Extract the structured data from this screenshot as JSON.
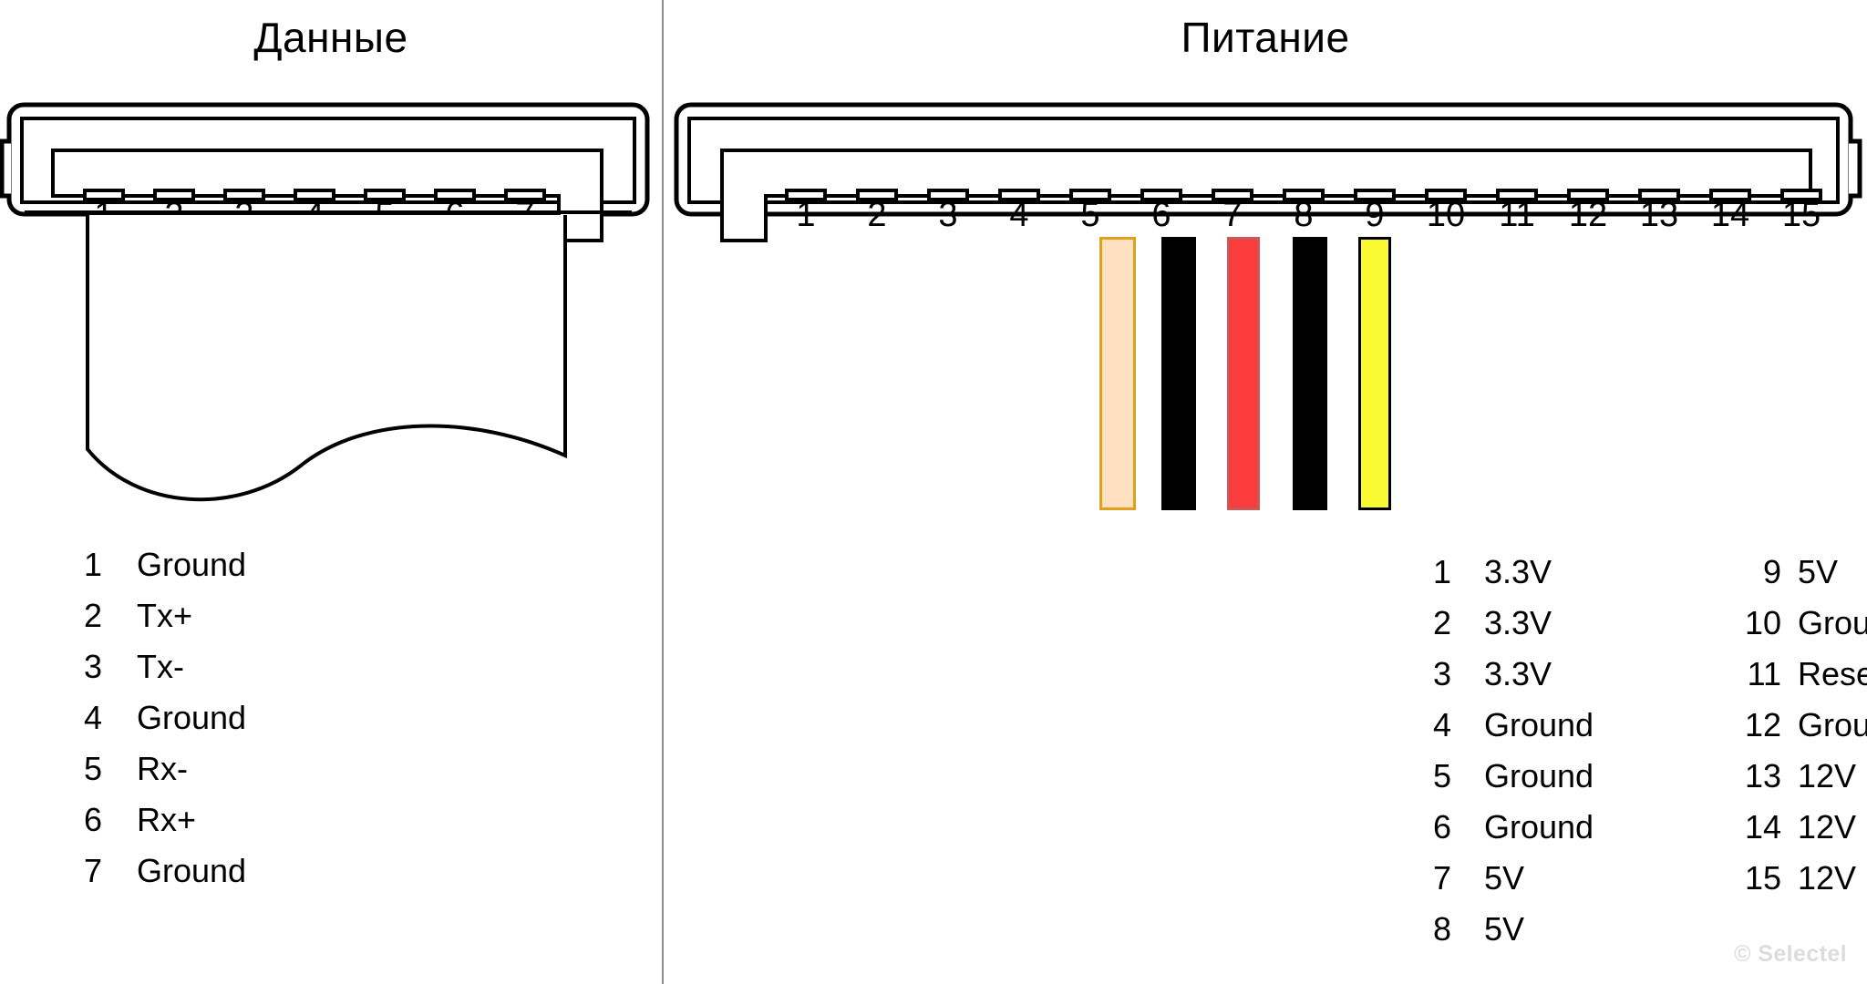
{
  "colors": {
    "outline": "#000000",
    "divider": "#8c8c8c",
    "background": "#ffffff",
    "watermark": "#dcdcdc",
    "wire_peach_fill": "#ffe0c0",
    "wire_peach_border": "#e0a01e",
    "wire_black": "#000000",
    "wire_red": "#fa3c3c",
    "wire_red_border": "#c85a5a",
    "wire_yellow": "#fafa32",
    "wire_yellow_border": "#000000"
  },
  "panels": {
    "data": {
      "title": "Данные",
      "connector": {
        "pin_count": 7,
        "pin_labels": [
          "1",
          "2",
          "3",
          "4",
          "5",
          "6",
          "7"
        ]
      },
      "pinout": [
        {
          "num": "1",
          "label": "Ground"
        },
        {
          "num": "2",
          "label": "Tx+"
        },
        {
          "num": "3",
          "label": "Tx-"
        },
        {
          "num": "4",
          "label": "Ground"
        },
        {
          "num": "5",
          "label": "Rx-"
        },
        {
          "num": "6",
          "label": "Rx+"
        },
        {
          "num": "7",
          "label": "Ground"
        }
      ]
    },
    "power": {
      "title": "Питание",
      "connector": {
        "pin_count": 15,
        "pin_labels": [
          "1",
          "2",
          "3",
          "4",
          "5",
          "6",
          "7",
          "8",
          "9",
          "10",
          "11",
          "12",
          "13",
          "14",
          "15"
        ]
      },
      "wires": [
        {
          "name": "wire-peach",
          "fill": "#ffe0c0",
          "border": "#e0a01e"
        },
        {
          "name": "wire-black-1",
          "fill": "#000000",
          "border": "#000000"
        },
        {
          "name": "wire-red",
          "fill": "#fa3c3c",
          "border": "#c85a5a"
        },
        {
          "name": "wire-black-2",
          "fill": "#000000",
          "border": "#000000"
        },
        {
          "name": "wire-yellow",
          "fill": "#fafa32",
          "border": "#000000"
        }
      ],
      "pinout_col1": [
        {
          "num": "1",
          "label": "3.3V"
        },
        {
          "num": "2",
          "label": "3.3V"
        },
        {
          "num": "3",
          "label": "3.3V"
        },
        {
          "num": "4",
          "label": "Ground"
        },
        {
          "num": "5",
          "label": "Ground"
        },
        {
          "num": "6",
          "label": "Ground"
        },
        {
          "num": "7",
          "label": "5V"
        },
        {
          "num": "8",
          "label": "5V"
        }
      ],
      "pinout_col2": [
        {
          "num": "9",
          "label": "5V"
        },
        {
          "num": "10",
          "label": "Ground"
        },
        {
          "num": "11",
          "label": "Reserved"
        },
        {
          "num": "12",
          "label": "Ground"
        },
        {
          "num": "13",
          "label": "12V"
        },
        {
          "num": "14",
          "label": "12V"
        },
        {
          "num": "15",
          "label": "12V"
        }
      ]
    }
  },
  "watermark": "© Selectel"
}
